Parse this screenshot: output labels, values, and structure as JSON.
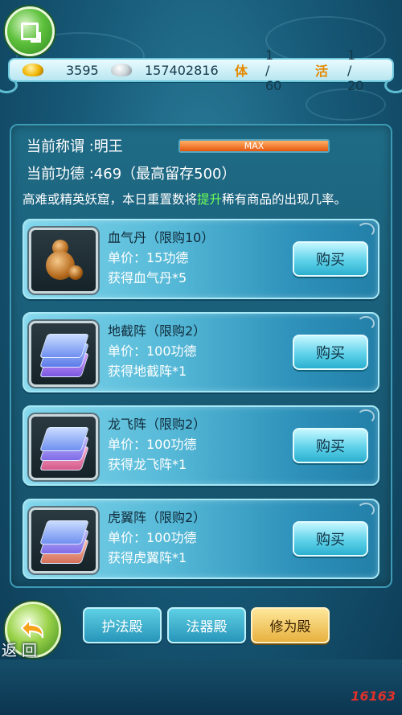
{
  "resources": {
    "gold": "3595",
    "silver": "157402816",
    "stamina_tag": "体",
    "stamina": "1 / 60",
    "activity_tag": "活",
    "activity": "1 / 20"
  },
  "status": {
    "title_label": "当前称谓",
    "title_value": ":明王",
    "merit_label": "当前功德",
    "merit_value": ":469（最高留存500）",
    "progress_text": "MAX",
    "progress_fraction": 1.0
  },
  "note": {
    "before": "高难或精英妖窟，本日重置数将",
    "highlight": "提升",
    "after": "稀有商品的出现几率。"
  },
  "items": [
    {
      "name": "血气丹（限购10）",
      "price": "单价：15功德",
      "gain": "获得血气丹*5",
      "buy": "购买",
      "icon": "gourd-icon"
    },
    {
      "name": "地截阵（限购2）",
      "price": "单价：100功德",
      "gain": "获得地截阵*1",
      "buy": "购买",
      "icon": "scroll-stack-icon"
    },
    {
      "name": "龙飞阵（限购2）",
      "price": "单价：100功德",
      "gain": "获得龙飞阵*1",
      "buy": "购买",
      "icon": "scroll-stack-icon"
    },
    {
      "name": "虎翼阵（限购2）",
      "price": "单价：100功德",
      "gain": "获得虎翼阵*1",
      "buy": "购买",
      "icon": "scroll-stack-icon"
    }
  ],
  "bottom": {
    "back_label": "返 回",
    "tabs": [
      {
        "label": "护法殿",
        "active": false
      },
      {
        "label": "法器殿",
        "active": false
      },
      {
        "label": "修为殿",
        "active": true
      }
    ],
    "watermark": "16163"
  }
}
